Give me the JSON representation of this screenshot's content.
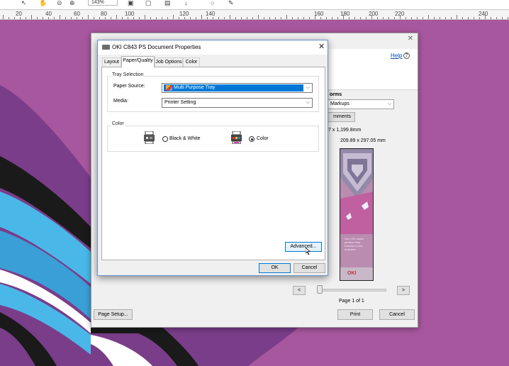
{
  "toolbar": {
    "zoom": "143%",
    "icons": [
      "select-arrow-icon",
      "hand-icon",
      "zoom-out-icon",
      "zoom-in-icon",
      "page-icon",
      "fit-icon",
      "image-icon",
      "download-icon",
      "comment-icon",
      "pen-icon"
    ]
  },
  "ruler": {
    "marks": [
      "20",
      "40",
      "60",
      "80",
      "100",
      "120",
      "140",
      "160",
      "180",
      "200",
      "220",
      "240"
    ]
  },
  "print_dialog": {
    "help": "Help",
    "forms_label": "orms",
    "markups_value": "Markups",
    "comments_button": "mments",
    "size_line1": "7 x 1,199.8mm",
    "size_line2": "209.89 x 297.05 mm",
    "preview_text": "Our LED colour printers help transform your business",
    "preview_logo": "OKI",
    "prev_button": "<",
    "next_button": ">",
    "page_label": "Page 1 of 1",
    "print_button": "Print",
    "cancel_button": "Cancel",
    "page_setup_button": "Page Setup..."
  },
  "doc_properties": {
    "title": "OKI C843 PS Document Properties",
    "tabs": [
      {
        "label": "Layout"
      },
      {
        "label": "Paper/Quality"
      },
      {
        "label": "Job Options"
      },
      {
        "label": "Color"
      }
    ],
    "tray_selection": {
      "legend": "Tray Selection",
      "paper_source_label": "Paper Source:",
      "paper_source_value": "Multi Purpose Tray",
      "media_label": "Media:",
      "media_value": "Printer Setting"
    },
    "color_group": {
      "legend": "Color",
      "bw_label": "Black & White",
      "color_label": "Color",
      "selected": "Color"
    },
    "advanced_button": "Advanced...",
    "ok_button": "OK",
    "cancel_button": "Cancel"
  },
  "colors": {
    "background_purple": "#a7579e",
    "accent_blue": "#0078d7",
    "sky_blue": "#49b8e8",
    "stripe_dark": "#1a1a1a"
  }
}
